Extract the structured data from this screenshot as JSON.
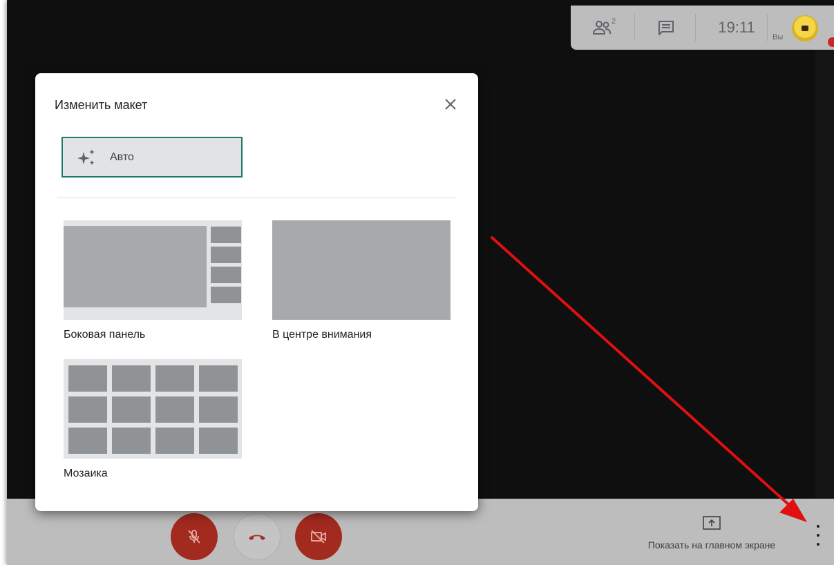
{
  "topbar": {
    "participants_icon": "people-icon",
    "participants_count": "2",
    "chat_icon": "chat-icon",
    "time": "19:11",
    "you_label": "Вы"
  },
  "dialog": {
    "title": "Изменить макет",
    "close_icon": "close-icon",
    "auto": {
      "icon": "sparkle-icon",
      "label": "Авто"
    },
    "options": [
      {
        "id": "sidebar",
        "label": "Боковая панель"
      },
      {
        "id": "spotlight",
        "label": "В центре внимания"
      },
      {
        "id": "mosaic",
        "label": "Мозаика"
      }
    ]
  },
  "bottombar": {
    "mic_icon": "mic-off-icon",
    "hangup_icon": "hang-up-icon",
    "camera_icon": "camera-off-icon",
    "present_icon": "present-screen-icon",
    "present_label": "Показать на главном экране",
    "more_icon": "more-vert-icon"
  },
  "colors": {
    "background": "#0f0f0f",
    "bar": "#bdbdbd",
    "selected_border": "#1e7a6a",
    "control_red": "#a32a1f",
    "annotation_arrow": "#e01010"
  }
}
